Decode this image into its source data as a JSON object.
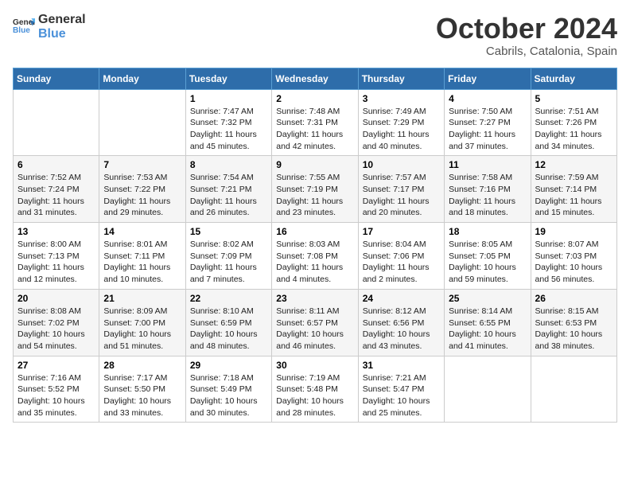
{
  "header": {
    "logo_line1": "General",
    "logo_line2": "Blue",
    "month": "October 2024",
    "location": "Cabrils, Catalonia, Spain"
  },
  "columns": [
    "Sunday",
    "Monday",
    "Tuesday",
    "Wednesday",
    "Thursday",
    "Friday",
    "Saturday"
  ],
  "weeks": [
    [
      {
        "day": "",
        "info": ""
      },
      {
        "day": "",
        "info": ""
      },
      {
        "day": "1",
        "info": "Sunrise: 7:47 AM\nSunset: 7:32 PM\nDaylight: 11 hours\nand 45 minutes."
      },
      {
        "day": "2",
        "info": "Sunrise: 7:48 AM\nSunset: 7:31 PM\nDaylight: 11 hours\nand 42 minutes."
      },
      {
        "day": "3",
        "info": "Sunrise: 7:49 AM\nSunset: 7:29 PM\nDaylight: 11 hours\nand 40 minutes."
      },
      {
        "day": "4",
        "info": "Sunrise: 7:50 AM\nSunset: 7:27 PM\nDaylight: 11 hours\nand 37 minutes."
      },
      {
        "day": "5",
        "info": "Sunrise: 7:51 AM\nSunset: 7:26 PM\nDaylight: 11 hours\nand 34 minutes."
      }
    ],
    [
      {
        "day": "6",
        "info": "Sunrise: 7:52 AM\nSunset: 7:24 PM\nDaylight: 11 hours\nand 31 minutes."
      },
      {
        "day": "7",
        "info": "Sunrise: 7:53 AM\nSunset: 7:22 PM\nDaylight: 11 hours\nand 29 minutes."
      },
      {
        "day": "8",
        "info": "Sunrise: 7:54 AM\nSunset: 7:21 PM\nDaylight: 11 hours\nand 26 minutes."
      },
      {
        "day": "9",
        "info": "Sunrise: 7:55 AM\nSunset: 7:19 PM\nDaylight: 11 hours\nand 23 minutes."
      },
      {
        "day": "10",
        "info": "Sunrise: 7:57 AM\nSunset: 7:17 PM\nDaylight: 11 hours\nand 20 minutes."
      },
      {
        "day": "11",
        "info": "Sunrise: 7:58 AM\nSunset: 7:16 PM\nDaylight: 11 hours\nand 18 minutes."
      },
      {
        "day": "12",
        "info": "Sunrise: 7:59 AM\nSunset: 7:14 PM\nDaylight: 11 hours\nand 15 minutes."
      }
    ],
    [
      {
        "day": "13",
        "info": "Sunrise: 8:00 AM\nSunset: 7:13 PM\nDaylight: 11 hours\nand 12 minutes."
      },
      {
        "day": "14",
        "info": "Sunrise: 8:01 AM\nSunset: 7:11 PM\nDaylight: 11 hours\nand 10 minutes."
      },
      {
        "day": "15",
        "info": "Sunrise: 8:02 AM\nSunset: 7:09 PM\nDaylight: 11 hours\nand 7 minutes."
      },
      {
        "day": "16",
        "info": "Sunrise: 8:03 AM\nSunset: 7:08 PM\nDaylight: 11 hours\nand 4 minutes."
      },
      {
        "day": "17",
        "info": "Sunrise: 8:04 AM\nSunset: 7:06 PM\nDaylight: 11 hours\nand 2 minutes."
      },
      {
        "day": "18",
        "info": "Sunrise: 8:05 AM\nSunset: 7:05 PM\nDaylight: 10 hours\nand 59 minutes."
      },
      {
        "day": "19",
        "info": "Sunrise: 8:07 AM\nSunset: 7:03 PM\nDaylight: 10 hours\nand 56 minutes."
      }
    ],
    [
      {
        "day": "20",
        "info": "Sunrise: 8:08 AM\nSunset: 7:02 PM\nDaylight: 10 hours\nand 54 minutes."
      },
      {
        "day": "21",
        "info": "Sunrise: 8:09 AM\nSunset: 7:00 PM\nDaylight: 10 hours\nand 51 minutes."
      },
      {
        "day": "22",
        "info": "Sunrise: 8:10 AM\nSunset: 6:59 PM\nDaylight: 10 hours\nand 48 minutes."
      },
      {
        "day": "23",
        "info": "Sunrise: 8:11 AM\nSunset: 6:57 PM\nDaylight: 10 hours\nand 46 minutes."
      },
      {
        "day": "24",
        "info": "Sunrise: 8:12 AM\nSunset: 6:56 PM\nDaylight: 10 hours\nand 43 minutes."
      },
      {
        "day": "25",
        "info": "Sunrise: 8:14 AM\nSunset: 6:55 PM\nDaylight: 10 hours\nand 41 minutes."
      },
      {
        "day": "26",
        "info": "Sunrise: 8:15 AM\nSunset: 6:53 PM\nDaylight: 10 hours\nand 38 minutes."
      }
    ],
    [
      {
        "day": "27",
        "info": "Sunrise: 7:16 AM\nSunset: 5:52 PM\nDaylight: 10 hours\nand 35 minutes."
      },
      {
        "day": "28",
        "info": "Sunrise: 7:17 AM\nSunset: 5:50 PM\nDaylight: 10 hours\nand 33 minutes."
      },
      {
        "day": "29",
        "info": "Sunrise: 7:18 AM\nSunset: 5:49 PM\nDaylight: 10 hours\nand 30 minutes."
      },
      {
        "day": "30",
        "info": "Sunrise: 7:19 AM\nSunset: 5:48 PM\nDaylight: 10 hours\nand 28 minutes."
      },
      {
        "day": "31",
        "info": "Sunrise: 7:21 AM\nSunset: 5:47 PM\nDaylight: 10 hours\nand 25 minutes."
      },
      {
        "day": "",
        "info": ""
      },
      {
        "day": "",
        "info": ""
      }
    ]
  ]
}
